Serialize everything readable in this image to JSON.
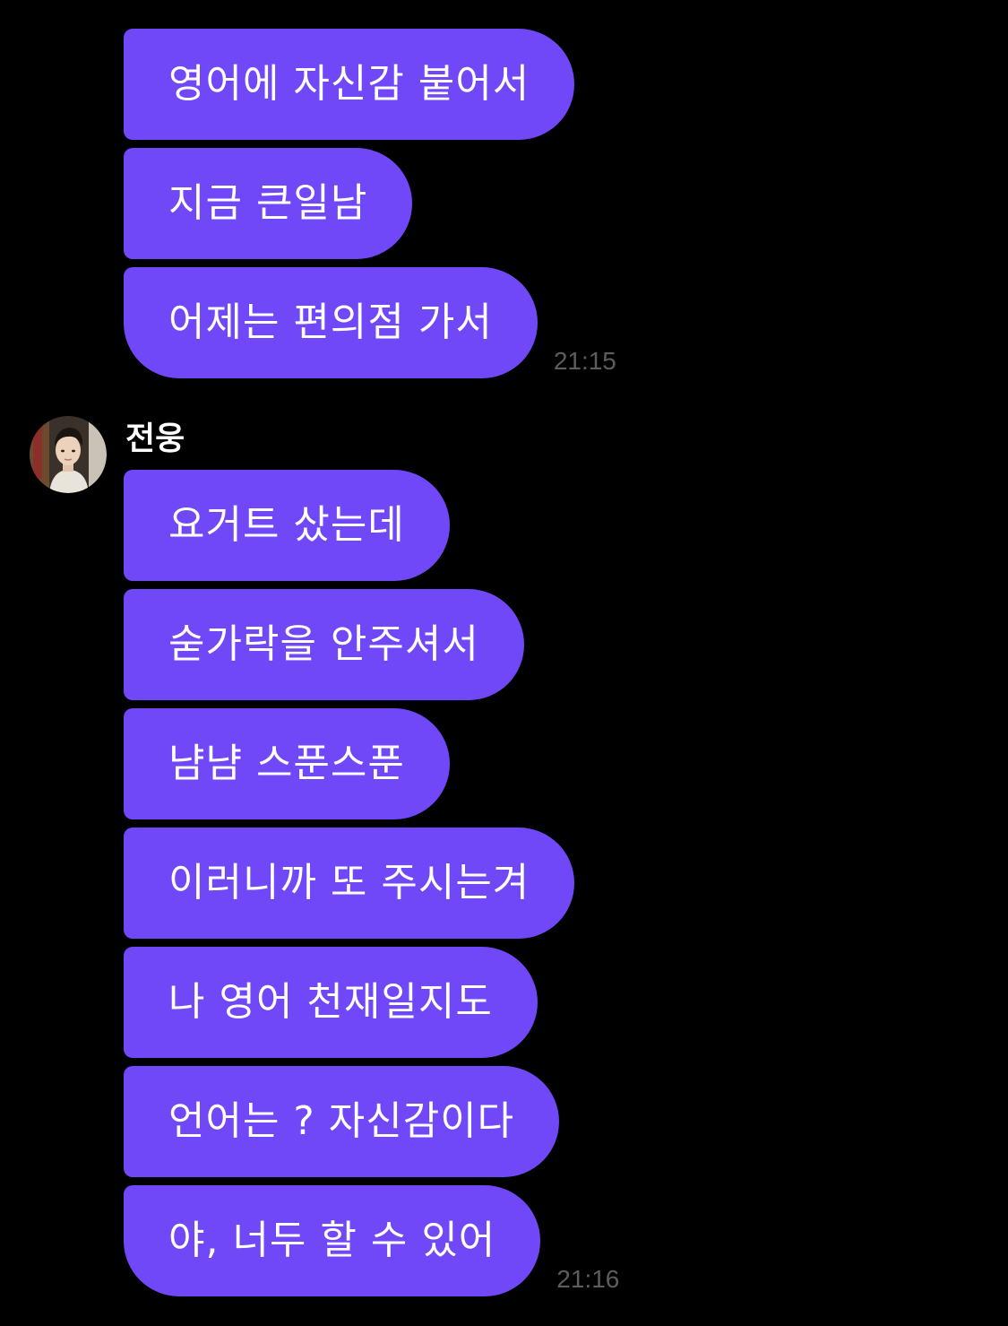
{
  "messages_top": {
    "bubbles": [
      {
        "text": "영어에 자신감 붙어서"
      },
      {
        "text": "지금 큰일남"
      },
      {
        "text": "어제는 편의점 가서"
      }
    ],
    "time": "21:15"
  },
  "messages_bottom": {
    "sender": {
      "name": "전웅",
      "avatar_icon": "profile-photo"
    },
    "bubbles": [
      {
        "text": "요거트 샀는데"
      },
      {
        "text": "숟가락을 안주셔서"
      },
      {
        "text": "냠냠 스푼스푼"
      },
      {
        "text": "이러니까 또 주시는겨"
      },
      {
        "text": "나 영어 천재일지도"
      },
      {
        "text": "언어는 ? 자신감이다"
      },
      {
        "text": "야, 너두 할 수 있어"
      }
    ],
    "time": "21:16"
  },
  "colors": {
    "background": "#000000",
    "bubble": "#7048f7",
    "bubble_text": "#ffffff",
    "timestamp": "#5d5d5d",
    "sender_name": "#ffffff"
  }
}
